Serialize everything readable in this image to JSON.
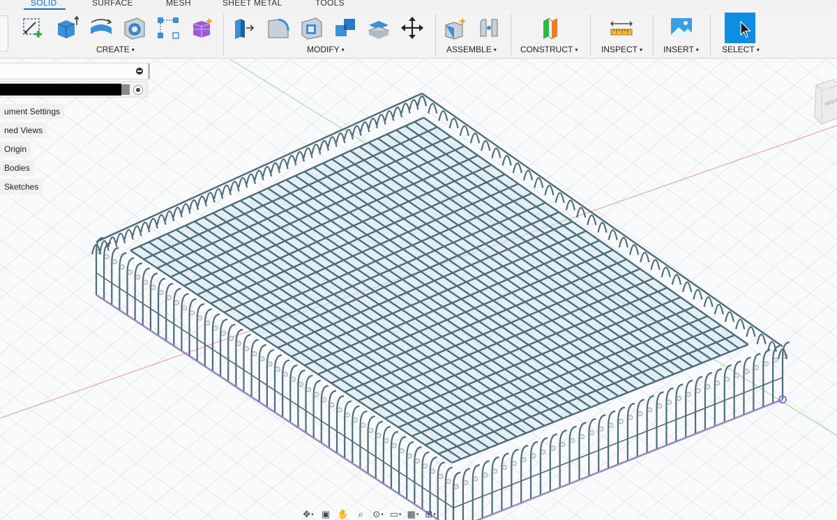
{
  "tabs": [
    {
      "label": "SOLID",
      "active": true
    },
    {
      "label": "SURFACE",
      "active": false
    },
    {
      "label": "MESH",
      "active": false
    },
    {
      "label": "SHEET METAL",
      "active": false
    },
    {
      "label": "TOOLS",
      "active": false
    }
  ],
  "toolbar": {
    "groups": {
      "create": {
        "label": "CREATE",
        "icons": [
          "new-sketch-icon",
          "extrude-icon",
          "revolve-icon",
          "hole-icon",
          "pattern-icon",
          "create-form-icon"
        ]
      },
      "modify": {
        "label": "MODIFY",
        "icons": [
          "press-pull-icon",
          "fillet-icon",
          "shell-icon",
          "combine-icon",
          "offset-face-icon",
          "move-copy-icon"
        ]
      },
      "assemble": {
        "label": "ASSEMBLE",
        "icons": [
          "new-component-icon",
          "joint-icon"
        ]
      },
      "construct": {
        "label": "CONSTRUCT",
        "icons": [
          "offset-plane-icon"
        ]
      },
      "inspect": {
        "label": "INSPECT",
        "icons": [
          "measure-icon"
        ]
      },
      "insert": {
        "label": "INSERT",
        "icons": [
          "insert-image-icon"
        ]
      },
      "select": {
        "label": "SELECT",
        "icons": [
          "select-cursor-icon"
        ]
      }
    },
    "caret": "▾"
  },
  "browser": {
    "items": [
      {
        "label": "ument Settings"
      },
      {
        "label": "ned Views"
      },
      {
        "label": "Origin"
      },
      {
        "label": "Bodies"
      },
      {
        "label": "Sketches"
      }
    ]
  },
  "viewcube": {
    "face_label": "RIGHT"
  },
  "navbar": {
    "icons": [
      "orbit-icon",
      "look-at-icon",
      "pan-icon",
      "zoom-icon",
      "fit-icon",
      "display-settings-icon",
      "grid-settings-icon",
      "viewports-icon"
    ]
  },
  "colors": {
    "accent": "#0f6fc6",
    "wire": "#4d6b7a",
    "glass": "#cfe8f1",
    "axis_red": "#e6a6a6",
    "axis_green": "#a6dca6"
  }
}
